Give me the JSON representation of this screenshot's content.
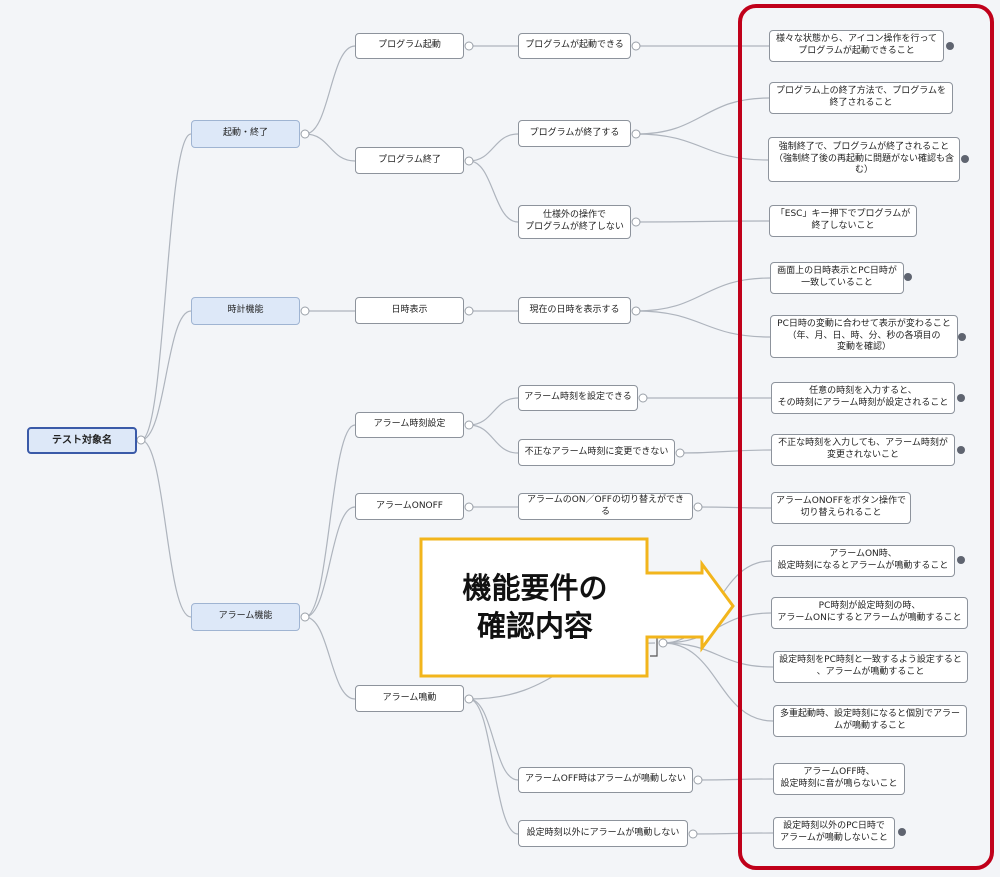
{
  "root": {
    "label": "テスト対象名"
  },
  "categories": [
    {
      "label": "起動・終了"
    },
    {
      "label": "時計機能"
    },
    {
      "label": "アラーム機能"
    }
  ],
  "features": [
    {
      "label": "プログラム起動"
    },
    {
      "label": "プログラム終了"
    },
    {
      "label": "日時表示"
    },
    {
      "label": "アラーム時刻設定"
    },
    {
      "label": "アラームONOFF"
    },
    {
      "label": "アラーム鳴動"
    }
  ],
  "conditions": [
    {
      "label": "プログラムが起動できる"
    },
    {
      "label": "プログラムが終了する"
    },
    {
      "label": "仕様外の操作で\nプログラムが終了しない"
    },
    {
      "label": "現在の日時を表示する"
    },
    {
      "label": "アラーム時刻を設定できる"
    },
    {
      "label": "不正なアラーム時刻に変更できない"
    },
    {
      "label": "アラームのON／OFFの切り替えができる"
    },
    {
      "label": "アラームOFF時はアラームが鳴動しない"
    },
    {
      "label": "設定時刻以外にアラームが鳴動しない"
    }
  ],
  "requirements": [
    {
      "label": "様々な状態から、アイコン操作を行って\nプログラムが起動できること"
    },
    {
      "label": "プログラム上の終了方法で、プログラムを\n終了されること"
    },
    {
      "label": "強制終了で、プログラムが終了されること\n（強制終了後の再起動に問題がない確認も含\nむ）"
    },
    {
      "label": "「ESC」キー押下でプログラムが\n終了しないこと"
    },
    {
      "label": "画面上の日時表示とPC日時が\n一致していること"
    },
    {
      "label": "PC日時の変動に合わせて表示が変わること\n（年、月、日、時、分、秒の各項目の\n変動を確認）"
    },
    {
      "label": "任意の時刻を入力すると、\nその時刻にアラーム時刻が設定されること"
    },
    {
      "label": "不正な時刻を入力しても、アラーム時刻が\n変更されないこと"
    },
    {
      "label": "アラームONOFFをボタン操作で\n切り替えられること"
    },
    {
      "label": "アラームON時、\n設定時刻になるとアラームが鳴動すること"
    },
    {
      "label": "PC時刻が設定時刻の時、\nアラームONにするとアラームが鳴動すること"
    },
    {
      "label": "設定時刻をPC時刻と一致するよう設定すると\n、アラームが鳴動すること"
    },
    {
      "label": "多重起動時、設定時刻になると個別でアラー\nムが鳴動すること"
    },
    {
      "label": "アラームOFF時、\n設定時刻に音が鳴らないこと"
    },
    {
      "label": "設定時刻以外のPC日時で\nアラームが鳴動しないこと"
    }
  ],
  "callout": {
    "line1": "機能要件の",
    "line2": "確認内容",
    "color": "#f2b51c"
  },
  "colors": {
    "frame": "#c0001a",
    "connector": "#aeb4bd",
    "root_border": "#3a5aa8",
    "category_fill": "#dde8f8"
  }
}
